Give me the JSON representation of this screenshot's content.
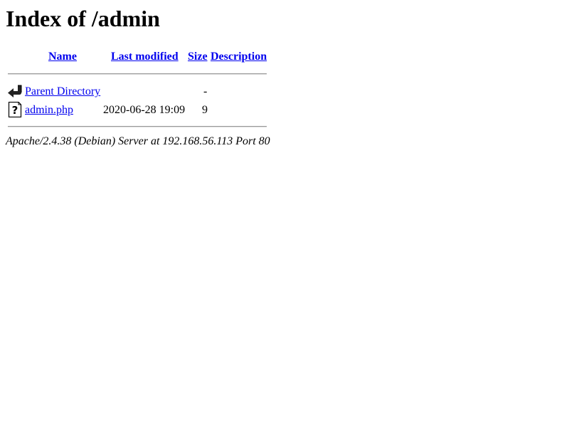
{
  "page": {
    "title": "Index of /admin"
  },
  "table": {
    "headers": {
      "name": "Name",
      "last_modified": "Last modified",
      "size": "Size",
      "description": "Description"
    },
    "rows": [
      {
        "icon": "back-arrow-icon",
        "name": "Parent Directory",
        "last_modified": "",
        "size": "-",
        "description": ""
      },
      {
        "icon": "unknown-file-icon",
        "name": "admin.php",
        "last_modified": "2020-06-28 19:09",
        "size": "9",
        "description": ""
      }
    ]
  },
  "footer": {
    "server_signature": "Apache/2.4.38 (Debian) Server at 192.168.56.113 Port 80"
  },
  "colors": {
    "link": "#0000ee",
    "text": "#000000",
    "rule": "#9a9a9a"
  }
}
